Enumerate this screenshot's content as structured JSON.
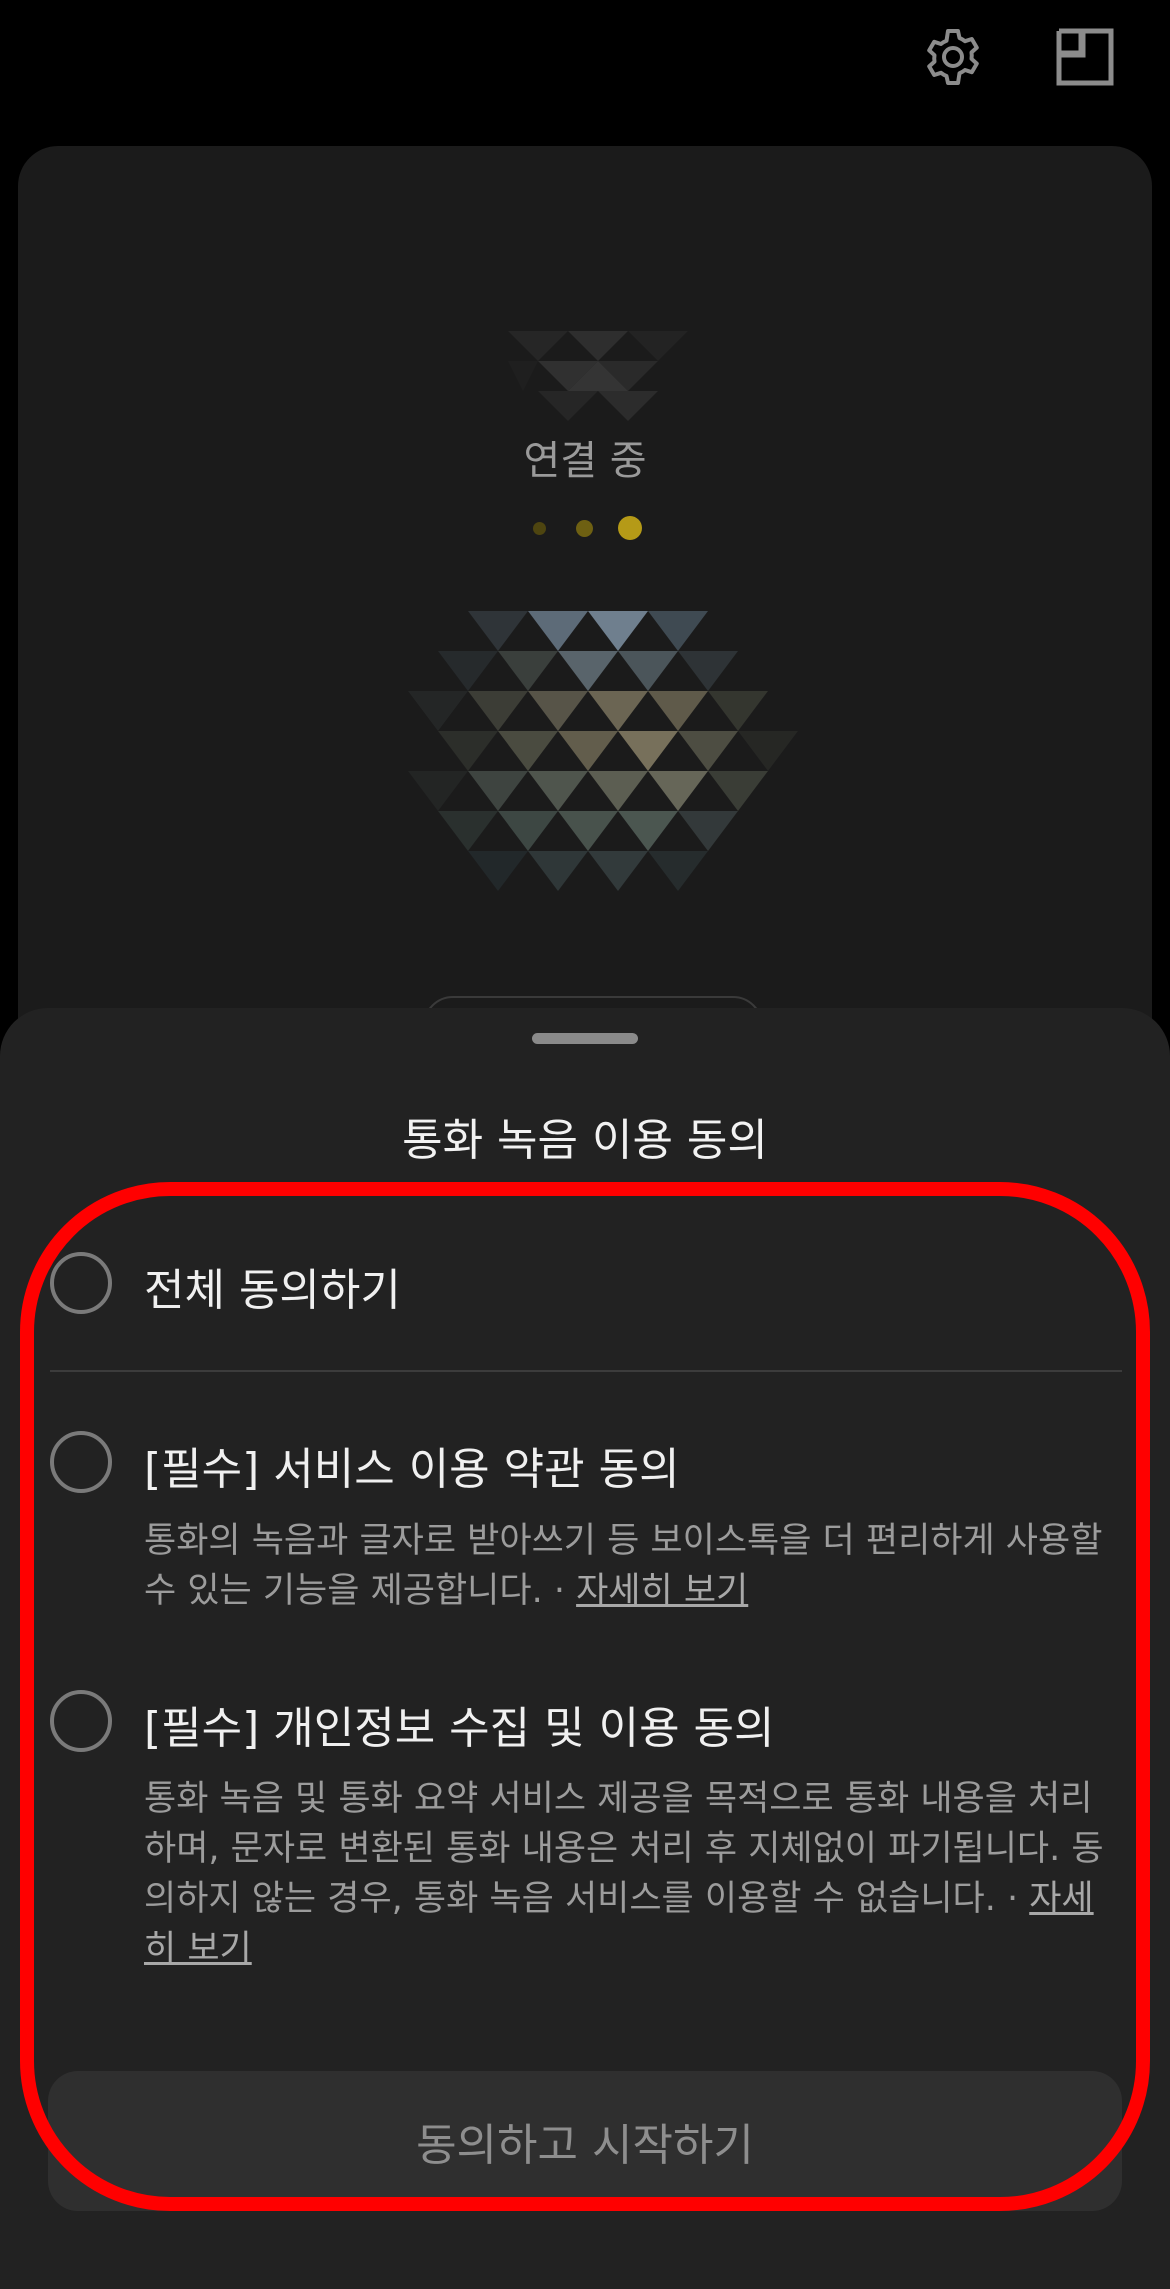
{
  "header": {
    "icons": [
      "gear-icon",
      "picture-in-picture-icon"
    ]
  },
  "call_card": {
    "status": "연결 중",
    "connecting_dots": 3,
    "accent_color": "#b59a17"
  },
  "sheet": {
    "title": "통화 녹음 이용 동의",
    "agree_all": {
      "label": "전체 동의하기",
      "checked": false
    },
    "items": [
      {
        "label": "[필수] 서비스 이용 약관 동의",
        "checked": false,
        "description": "통화의 녹음과 글자로 받아쓰기 등 보이스톡을 더 편리하게 사용할 수 있는 기능을 제공합니다. · ",
        "link": "자세히 보기"
      },
      {
        "label": "[필수] 개인정보 수집 및 이용 동의",
        "checked": false,
        "description": "통화 녹음 및 통화 요약 서비스 제공을 목적으로 통화 내용을 처리하며, 문자로 변환된 통화 내용은 처리 후 지체없이 파기됩니다. 동의하지 않는 경우, 통화 녹음 서비스를 이용할 수 없습니다. · ",
        "link": "자세히 보기"
      }
    ],
    "start_button": "동의하고 시작하기"
  },
  "annotation": {
    "outline_color": "#ff0000"
  }
}
